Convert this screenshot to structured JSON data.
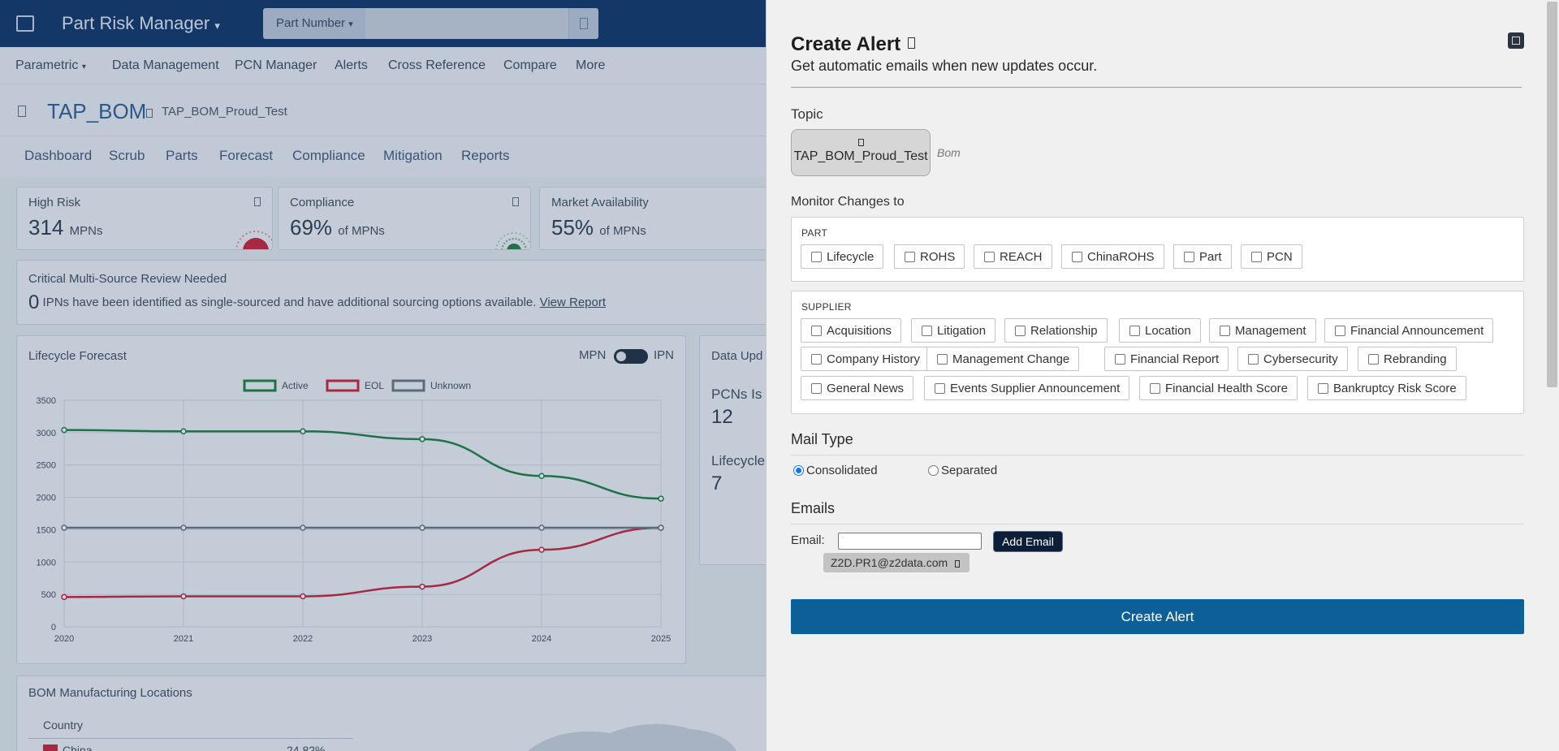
{
  "app": {
    "title": "Part Risk Manager",
    "title_caret": "▾"
  },
  "search": {
    "type_label": "Part Number",
    "type_caret": "▾",
    "placeholder": ""
  },
  "nav": {
    "items": [
      "Parametric",
      "Data Management",
      "PCN Manager",
      "Alerts",
      "Cross Reference",
      "Compare",
      "More"
    ],
    "parametric_caret": "▾"
  },
  "bom": {
    "title": "TAP_BOM",
    "subtitle": "TAP_BOM_Proud_Test"
  },
  "tabs": [
    "Dashboard",
    "Scrub",
    "Parts",
    "Forecast",
    "Compliance",
    "Mitigation",
    "Reports"
  ],
  "cards": [
    {
      "title": "High Risk",
      "value": "314",
      "unit": "MPNs"
    },
    {
      "title": "Compliance",
      "value": "69%",
      "unit": "of MPNs"
    },
    {
      "title": "Market Availability",
      "value": "55%",
      "unit": "of MPNs"
    }
  ],
  "critical": {
    "title": "Critical Multi-Source Review Needed",
    "count": "0",
    "text": " IPNs have been identified as single-sourced and have additional sourcing options available. ",
    "link": "View Report"
  },
  "lifecycle": {
    "title": "Lifecycle Forecast",
    "toggle_left": "MPN",
    "toggle_right": "IPN"
  },
  "data_update": {
    "title": "Data Upd",
    "pcns_label": "PCNs Is",
    "pcns_value": "12",
    "lifecycle_label": "Lifecycle",
    "lifecycle_value": "7"
  },
  "locations": {
    "title": "BOM Manufacturing Locations",
    "col": "Country",
    "row_country": "China",
    "row_value": "24.82%"
  },
  "colors": {
    "active": "#1b7d3c",
    "eol": "#c91f37",
    "unknown": "#6b7480",
    "header_bg": "#0c3266",
    "create_btn": "#0d5f98"
  },
  "chart_data": {
    "type": "line",
    "title": "",
    "xlabel": "",
    "ylabel": "",
    "x": [
      2020,
      2021,
      2022,
      2023,
      2024,
      2025
    ],
    "ylim": [
      0,
      3500
    ],
    "yticks": [
      0,
      500,
      1000,
      1500,
      2000,
      2500,
      3000,
      3500
    ],
    "legend_position": "top",
    "grid": true,
    "series": [
      {
        "name": "Active",
        "values": [
          3040,
          3020,
          3020,
          2900,
          2330,
          1980
        ]
      },
      {
        "name": "EOL",
        "values": [
          460,
          470,
          470,
          620,
          1190,
          1530
        ]
      },
      {
        "name": "Unknown",
        "values": [
          1530,
          1530,
          1530,
          1530,
          1530,
          1530
        ]
      }
    ]
  },
  "panel": {
    "title": "Create Alert",
    "subtitle": "Get automatic emails when new updates occur.",
    "topic_label": "Topic",
    "topic_name": "TAP_BOM_Proud_Test",
    "topic_type": "Bom",
    "monitor_label": "Monitor Changes to",
    "part_label": "PART",
    "part_options": [
      "Lifecycle",
      "ROHS",
      "REACH",
      "ChinaROHS",
      "Part",
      "PCN"
    ],
    "supplier_label": "SUPPLIER",
    "supplier_options": [
      "Acquisitions",
      "Litigation",
      "Relationship",
      "Location",
      "Management",
      "Financial Announcement",
      "Company History",
      "Management Change",
      "Financial Report",
      "Cybersecurity",
      "Rebranding",
      "General News",
      "Events Supplier Announcement",
      "Financial Health Score",
      "Bankruptcy Risk Score"
    ],
    "mail_type_label": "Mail Type",
    "mail_options": [
      "Consolidated",
      "Separated"
    ],
    "mail_selected": "Consolidated",
    "emails_label": "Emails",
    "email_field_label": "Email:",
    "email_value": "",
    "add_email_label": "Add Email",
    "email_chips": [
      "Z2D.PR1@z2data.com"
    ],
    "create_label": "Create Alert"
  }
}
